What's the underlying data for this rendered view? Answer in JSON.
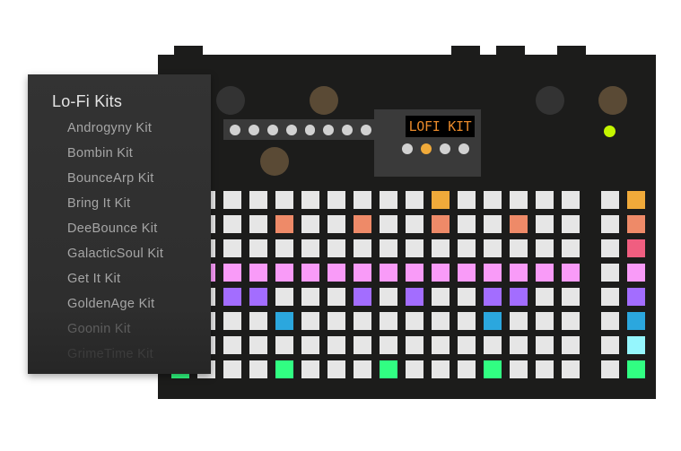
{
  "device": {
    "display_text": "LOFI KIT",
    "top_knobs": [
      "dark",
      "brown",
      "dark",
      "brown"
    ],
    "lower_knob": "brown",
    "step_leds_count": 8,
    "mode_leds": [
      {
        "state": "off"
      },
      {
        "state": "on"
      },
      {
        "state": "off"
      },
      {
        "state": "off"
      }
    ],
    "status_led_color": "#c4f500",
    "colors": {
      "pad_off": "#e6e6e6",
      "orange": "#f0aa3a",
      "salmon": "#ee8a68",
      "red": "#f05e80",
      "pink": "#f99bf8",
      "purple": "#a36dff",
      "blue": "#2ba7de",
      "cyan": "#95f6fd",
      "green": "#31fe82",
      "lcd_text": "#e8892a"
    },
    "pad_rows": [
      {
        "track": "orange",
        "active_steps": [
          10
        ],
        "mute": false,
        "select_color": "orange"
      },
      {
        "track": "salmon",
        "active_steps": [
          0,
          4,
          7,
          10,
          13
        ],
        "mute": false,
        "select_color": "salmon"
      },
      {
        "track": "red",
        "active_steps": [
          0
        ],
        "mute": false,
        "select_color": "red"
      },
      {
        "track": "pink",
        "active_steps": [
          0,
          1,
          2,
          3,
          4,
          5,
          6,
          7,
          8,
          9,
          10,
          11,
          12,
          13,
          14,
          15
        ],
        "mute": false,
        "select_color": "pink"
      },
      {
        "track": "purple",
        "active_steps": [
          0,
          2,
          3,
          7,
          9,
          12,
          13
        ],
        "mute": false,
        "select_color": "purple"
      },
      {
        "track": "blue",
        "active_steps": [
          4,
          12
        ],
        "mute": false,
        "select_color": "blue"
      },
      {
        "track": "cyan",
        "active_steps": [],
        "mute": false,
        "select_color": "cyan"
      },
      {
        "track": "green",
        "active_steps": [
          0,
          4,
          8,
          12
        ],
        "mute": false,
        "select_color": "green"
      }
    ]
  },
  "kit_menu": {
    "title": "Lo-Fi Kits",
    "items": [
      {
        "label": "Androgyny Kit",
        "visibility": "full"
      },
      {
        "label": "Bombin Kit",
        "visibility": "full"
      },
      {
        "label": "BounceArp Kit",
        "visibility": "full"
      },
      {
        "label": "Bring It Kit",
        "visibility": "full"
      },
      {
        "label": "DeeBounce Kit",
        "visibility": "full"
      },
      {
        "label": "GalacticSoul Kit",
        "visibility": "full"
      },
      {
        "label": "Get It Kit",
        "visibility": "full"
      },
      {
        "label": "GoldenAge Kit",
        "visibility": "full"
      },
      {
        "label": "Goonin Kit",
        "visibility": "faded"
      },
      {
        "label": "GrimeTime Kit",
        "visibility": "very-faded"
      }
    ]
  }
}
